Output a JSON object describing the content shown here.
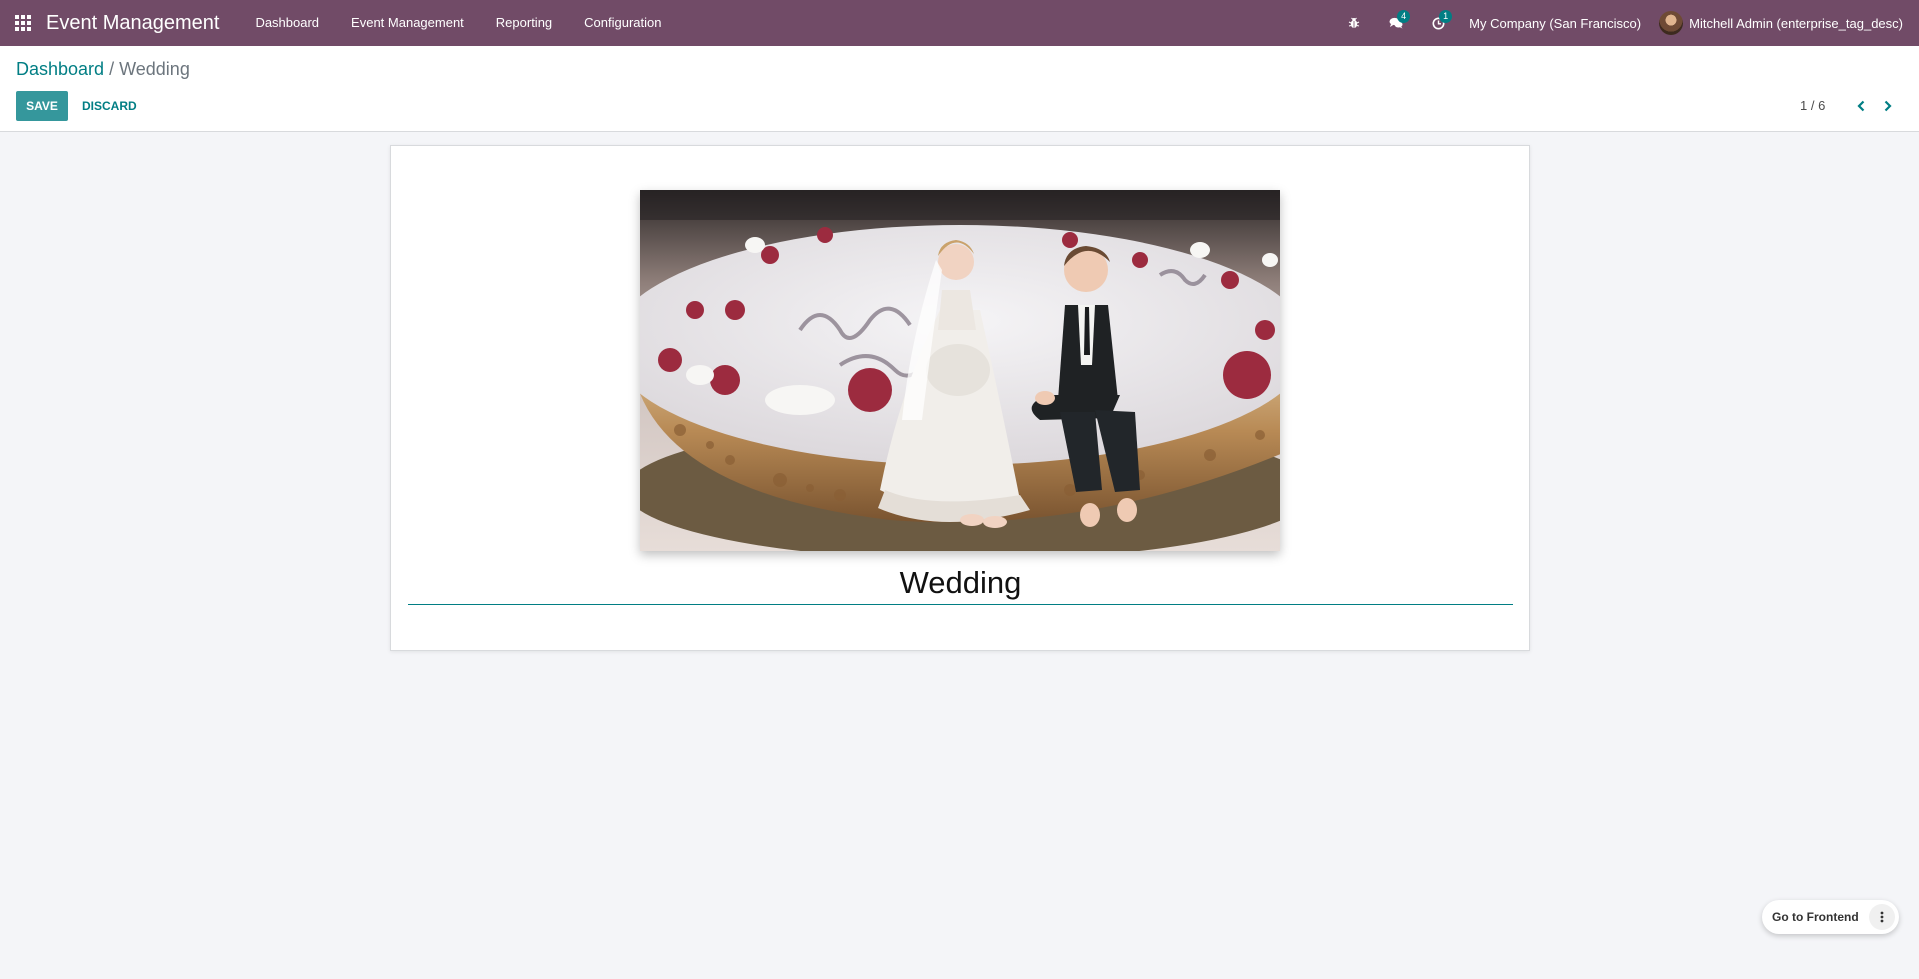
{
  "navbar": {
    "apps_icon": "apps-grid-icon",
    "brand": "Event Management",
    "menu": [
      {
        "label": "Dashboard"
      },
      {
        "label": "Event Management"
      },
      {
        "label": "Reporting"
      },
      {
        "label": "Configuration"
      }
    ],
    "debug_icon": "bug-icon",
    "messages_icon": "chat-icon",
    "messages_count": "4",
    "activities_icon": "clock-icon",
    "activities_count": "1",
    "company": "My Company (San Francisco)",
    "user_name": "Mitchell Admin (enterprise_tag_desc)"
  },
  "breadcrumb": {
    "parent": "Dashboard",
    "separator": "/",
    "current": "Wedding"
  },
  "actions": {
    "save_label": "SAVE",
    "discard_label": "DISCARD"
  },
  "pager": {
    "value": "1 / 6",
    "prev_icon": "chevron-left-icon",
    "next_icon": "chevron-right-icon"
  },
  "form": {
    "name_value": "Wedding",
    "cover_image": "wedding-cake-topper-photo"
  },
  "floating": {
    "go_frontend_label": "Go to Frontend",
    "more_icon": "vertical-dots-icon"
  },
  "colors": {
    "navbar": "#714b67",
    "primary": "#017e84",
    "save_button": "#35979c",
    "background": "#f4f5f8"
  }
}
